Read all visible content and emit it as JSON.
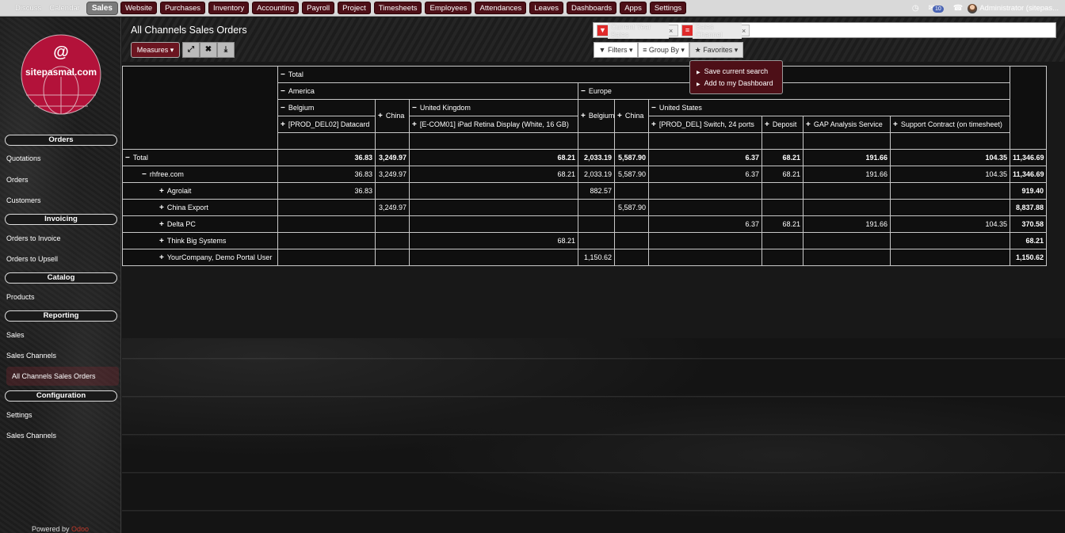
{
  "topbar": {
    "plain_items": [
      "Discuss",
      "Calendar"
    ],
    "active_item": "Sales",
    "items": [
      "Website",
      "Purchases",
      "Inventory",
      "Accounting",
      "Payroll",
      "Project",
      "Timesheets",
      "Employees",
      "Attendances",
      "Leaves",
      "Dashboards",
      "Apps",
      "Settings"
    ],
    "clock_icon": "clock-icon",
    "chat_icon": "chat-icon",
    "message_count": "10",
    "bell_icon": "bell-icon",
    "user_name": "Administrator (sitepas..."
  },
  "sidebar": {
    "logo_text": "sitepasmal.com",
    "logo_symbol": "@",
    "sections": [
      {
        "title": "Orders",
        "items": [
          "Quotations",
          "Orders",
          "Customers"
        ]
      },
      {
        "title": "Invoicing",
        "items": [
          "Orders to Invoice",
          "Orders to Upsell"
        ]
      },
      {
        "title": "Catalog",
        "items": [
          "Products"
        ]
      },
      {
        "title": "Reporting",
        "items": [
          "Sales",
          "Sales Channels",
          "All Channels Sales Orders"
        ]
      },
      {
        "title": "Configuration",
        "items": [
          "Settings",
          "Sales Channels"
        ]
      }
    ],
    "active_item": "All Channels Sales Orders",
    "powered_by": "Powered by",
    "powered_brand": "Odoo"
  },
  "control_panel": {
    "title": "All Channels Sales Orders",
    "measures_label": "Measures",
    "expand_icon": "expand-icon",
    "flip_icon": "flip-axis-icon",
    "download_icon": "download-icon",
    "facets": [
      {
        "icon": "filter-icon",
        "value": "Current Year Sales"
      },
      {
        "icon": "group-by-icon",
        "value": "Sales Channel"
      }
    ],
    "filters_label": "Filters",
    "groupby_label": "Group By",
    "favorites_label": "Favorites",
    "favorites_menu": [
      "Save current search",
      "Add to my Dashboard"
    ]
  },
  "pivot": {
    "col_header_total": "Total",
    "col_level1": [
      "America",
      "Europe"
    ],
    "col_level2": [
      "Belgium",
      "China",
      "United Kingdom",
      "Belgium",
      "China",
      "United States"
    ],
    "col_level3": [
      "[PROD_DEL02] Datacard",
      "[E-COM01] iPad Retina Display (White, 16 GB)",
      "[PROD_DEL] Switch, 24 ports",
      "Deposit",
      "GAP Analysis Service",
      "Support Contract (on timesheet)"
    ],
    "rows": [
      {
        "label": "Total",
        "sign": "−",
        "values": [
          "36.83",
          "3,249.97",
          "68.21",
          "2,033.19",
          "5,587.90",
          "6.37",
          "68.21",
          "191.66",
          "104.35",
          "11,346.69"
        ],
        "bold": true
      },
      {
        "label": "rhfree.com",
        "sign": "−",
        "values": [
          "36.83",
          "3,249.97",
          "68.21",
          "2,033.19",
          "5,587.90",
          "6.37",
          "68.21",
          "191.66",
          "104.35",
          "11,346.69"
        ]
      },
      {
        "label": "Agrolait",
        "sign": "+",
        "values": [
          "36.83",
          "",
          "",
          "882.57",
          "",
          "",
          "",
          "",
          "",
          "919.40"
        ]
      },
      {
        "label": "China Export",
        "sign": "+",
        "values": [
          "",
          "3,249.97",
          "",
          "",
          "5,587.90",
          "",
          "",
          "",
          "",
          "8,837.88"
        ]
      },
      {
        "label": "Delta PC",
        "sign": "+",
        "values": [
          "",
          "",
          "",
          "",
          "",
          "6.37",
          "68.21",
          "191.66",
          "104.35",
          "370.58"
        ]
      },
      {
        "label": "Think Big Systems",
        "sign": "+",
        "values": [
          "",
          "",
          "68.21",
          "",
          "",
          "",
          "",
          "",
          "",
          "68.21"
        ]
      },
      {
        "label": "YourCompany, Demo Portal User",
        "sign": "+",
        "values": [
          "",
          "",
          "",
          "1,150.62",
          "",
          "",
          "",
          "",
          "",
          "1,150.62"
        ]
      }
    ]
  },
  "colors": {
    "brand_maroon": "#4d0f17",
    "logo_red": "#b3123a",
    "facet_red": "#e02b2b"
  }
}
